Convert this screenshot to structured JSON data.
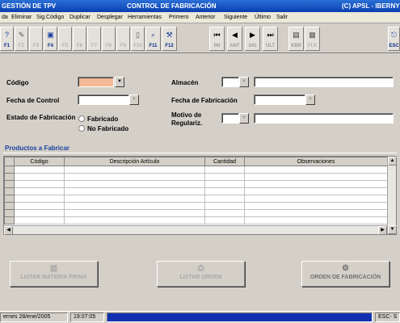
{
  "window": {
    "app_title": "GESTIÓN DE TPV",
    "form_title": "CONTROL DE FABRICACIÓN",
    "company": "(C) APSL - IBERNY"
  },
  "menu": [
    "da",
    "Eliminar",
    "Sig.Código",
    "Duplicar",
    "Desplegar",
    "Herramientas",
    "Primero",
    "Anterior",
    "Siguiente",
    "Último",
    "Salir"
  ],
  "toolbar": {
    "fkeys": [
      "F1",
      "F2",
      "F3",
      "F4",
      "F5",
      "F6",
      "F7",
      "F8",
      "F9",
      "F10",
      "F11",
      "F12"
    ],
    "nav": [
      "INI",
      "ANT",
      "SIG",
      "ÚLT"
    ],
    "extra": [
      "KBR",
      "FLX"
    ],
    "esc": "ESC"
  },
  "form": {
    "codigo_label": "Código",
    "codigo_value": "",
    "fecha_control_label": "Fecha de Control",
    "fecha_control_value": "",
    "estado_label": "Estado de Fabricación",
    "estado_options": [
      "Fabricado",
      "No Fabricado"
    ],
    "almacen_label": "Almacén",
    "almacen_value": "",
    "fecha_fabricacion_label": "Fecha de Fabricación",
    "fecha_fabricacion_value": "",
    "motivo_label_1": "Motivo de",
    "motivo_label_2": "Regulariz.",
    "motivo_value": ""
  },
  "products": {
    "section_title": "Productos a Fabricar",
    "columns": [
      "Código",
      "Descripción Artículo",
      "Cantidad",
      "Observaciones"
    ],
    "rows": []
  },
  "actions": {
    "listar_materia": "LISTAR MATERIA PRIMA",
    "listar_orden": "LISTAR ORDEN",
    "orden_fabricacion": "ORDEN DE FABRICACIÓN"
  },
  "status": {
    "date": "ernes  28/ene/2005",
    "time": "19:07:05",
    "right": "ESC- S"
  },
  "colors": {
    "title_bar": "#0a3fb0",
    "codigo_field_bg": "#f4b996",
    "status_blue": "#1030b0",
    "section_title": "#1a3fa0"
  }
}
